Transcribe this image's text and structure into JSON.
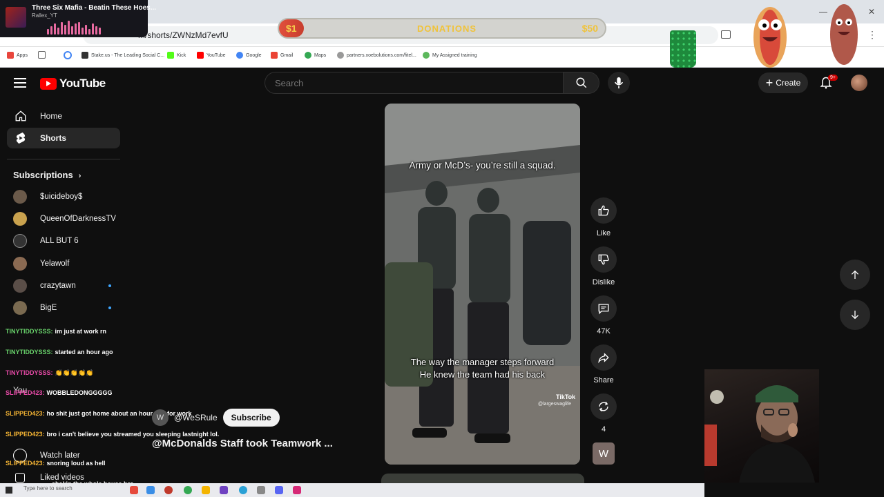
{
  "music": {
    "title": "Three Six Mafia - Beatin These Hoes...",
    "artist": "Rallex_YT"
  },
  "donations": {
    "low": "$1",
    "label": "DONATIONS",
    "high": "$50",
    "progress": 0.06
  },
  "browser": {
    "url_fragment": "m/shorts/ZWNzMd7evfU",
    "bookmarks": [
      "Apps",
      "Stake.us - The Leading Social C...",
      "Kick",
      "YouTube",
      "Google",
      "Gmail",
      "Maps",
      "partners.xoebolutions.com/fitel...",
      "My Assigned training"
    ],
    "colors": {
      "tab_bar": "#dfe3e8"
    }
  },
  "header": {
    "logo": "YouTube",
    "search_placeholder": "Search",
    "create_label": "Create",
    "notifications_badge": "9+"
  },
  "sidebar": {
    "items": [
      {
        "label": "Home",
        "icon": "home-icon"
      },
      {
        "label": "Shorts",
        "icon": "shorts-icon"
      }
    ],
    "subscriptions_title": "Subscriptions",
    "subscriptions": [
      {
        "name": "$uicideboy$",
        "color": "#6b5a4a",
        "live": false
      },
      {
        "name": "QueenOfDarknessTV",
        "color": "#c9a24e",
        "live": false
      },
      {
        "name": "ALL BUT 6",
        "color": "#333333",
        "live": false
      },
      {
        "name": "Yelawolf",
        "color": "#8a6a52",
        "live": false
      },
      {
        "name": "crazytawn",
        "color": "#5a4e48",
        "live": true
      },
      {
        "name": "BigE",
        "color": "#7a6a50",
        "live": true
      }
    ],
    "you_label": "You",
    "watch_later": "Watch later",
    "liked_videos": "Liked videos"
  },
  "chat": [
    {
      "user": "TINYTIDDYSSS:",
      "color": "#69d26b",
      "msg": "im just at work rn"
    },
    {
      "user": "TINYTIDDYSSS:",
      "color": "#69d26b",
      "msg": "started an hour ago"
    },
    {
      "user": "TINYTIDDYSSS:",
      "color": "#e64aa6",
      "msg": "👏👏👏👏👏"
    },
    {
      "user": "SLIPPED423:",
      "color": "#e64aa6",
      "msg": "WOBBLEDONGGGGG"
    },
    {
      "user": "SLIPPED423:",
      "color": "#f2b233",
      "msg": "ho shit just got home about an hour ago for work"
    },
    {
      "user": "SLIPPED423:",
      "color": "#f2b233",
      "msg": "bro i can't believe you streamed you sleeping lastnight lol."
    },
    {
      "user": "SLIPPED423:",
      "color": "#f2b233",
      "msg": "snoring loud as hell"
    },
    {
      "user": "",
      "color": "#f2b233",
      "msg": "shakin the whole house bro"
    }
  ],
  "video": {
    "caption_top": "Army or McD’s- you’re still a squad.",
    "caption_bottom_1": "The way the manager steps forward",
    "caption_bottom_2": "He knew the team had his back",
    "watermark": "TikTok",
    "watermark_handle": "@largeswaglife",
    "channel": "@WeSRule",
    "channel_initial": "W",
    "subscribe_label": "Subscribe",
    "title": "@McDonalds Staff took Teamwork ..."
  },
  "actions": {
    "like": "Like",
    "dislike": "Dislike",
    "comments": "47K",
    "share": "Share",
    "remix": "4",
    "channel_initial": "W"
  },
  "taskbar": {
    "search": "Type here to search"
  }
}
